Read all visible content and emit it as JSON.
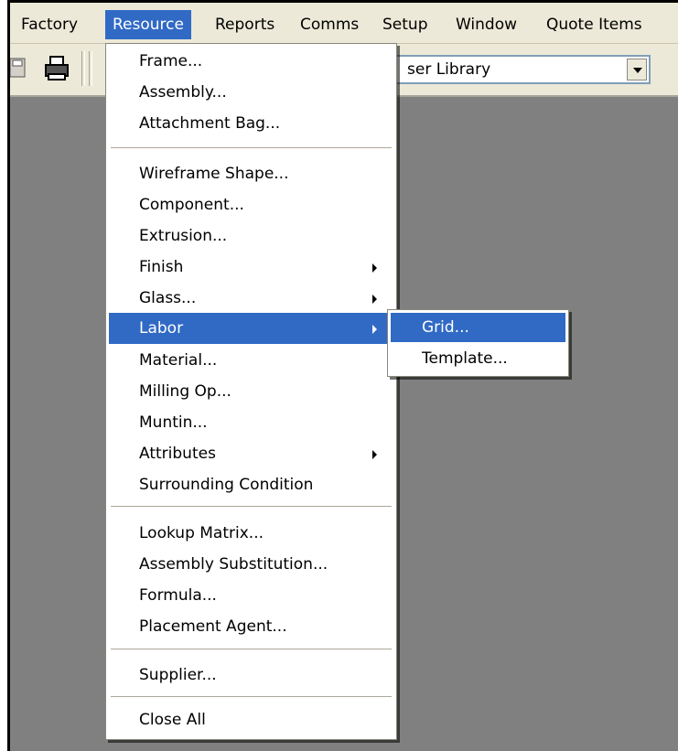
{
  "menubar": {
    "items": [
      {
        "label": "Factory"
      },
      {
        "label": "Resource"
      },
      {
        "label": "Reports"
      },
      {
        "label": "Comms"
      },
      {
        "label": "Setup"
      },
      {
        "label": "Window"
      },
      {
        "label": "Quote Items"
      }
    ],
    "active": "Resource"
  },
  "toolbar": {
    "library_combo_value": "ser Library",
    "icons": [
      "save-icon",
      "printer-icon"
    ]
  },
  "resource_menu": {
    "items": [
      {
        "label": "Frame..."
      },
      {
        "label": "Assembly..."
      },
      {
        "label": "Attachment Bag..."
      },
      {
        "label": "Wireframe Shape..."
      },
      {
        "label": "Component..."
      },
      {
        "label": "Extrusion..."
      },
      {
        "label": "Finish",
        "submenu": true
      },
      {
        "label": "Glass...",
        "submenu": true
      },
      {
        "label": "Labor",
        "submenu": true,
        "highlighted": true
      },
      {
        "label": "Material..."
      },
      {
        "label": "Milling Op..."
      },
      {
        "label": "Muntin..."
      },
      {
        "label": "Attributes",
        "submenu": true
      },
      {
        "label": "Surrounding Condition"
      },
      {
        "label": "Lookup Matrix..."
      },
      {
        "label": "Assembly Substitution..."
      },
      {
        "label": "Formula..."
      },
      {
        "label": "Placement Agent..."
      },
      {
        "label": "Supplier..."
      },
      {
        "label": "Close All"
      }
    ]
  },
  "labor_submenu": {
    "items": [
      {
        "label": "Grid...",
        "highlighted": true
      },
      {
        "label": "Template..."
      }
    ]
  },
  "colors": {
    "highlight": "#316ac5",
    "menubar_bg": "#ece9d8",
    "workspace_bg": "#808080"
  }
}
